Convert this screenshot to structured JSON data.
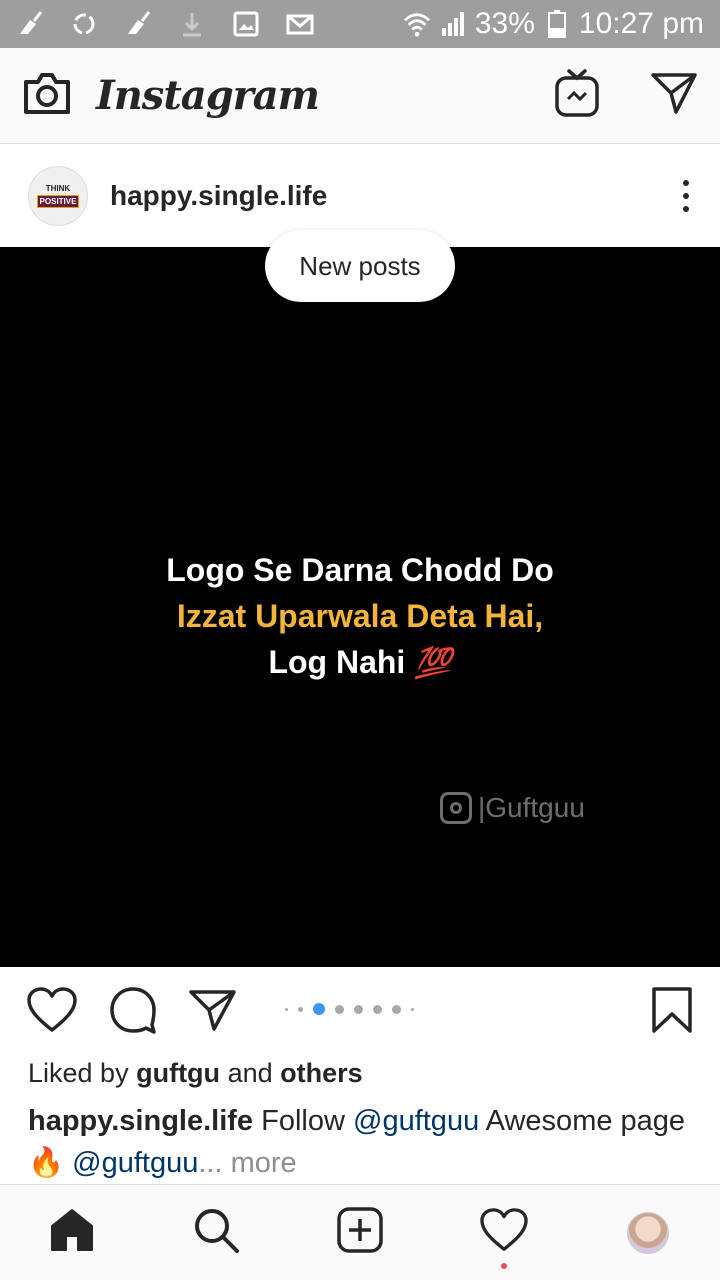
{
  "status_bar": {
    "battery": "33%",
    "time": "10:27 pm",
    "icons": [
      "broom-icon",
      "sync-icon",
      "broom-icon",
      "download-icon",
      "image-icon",
      "mail-icon",
      "wifi-icon",
      "signal-icon",
      "battery-icon"
    ]
  },
  "app_bar": {
    "title": "Instagram",
    "left_icon": "camera-icon",
    "right_icons": [
      "igtv-icon",
      "direct-message-icon"
    ]
  },
  "post": {
    "username": "happy.single.life",
    "avatar_text_top": "THINK",
    "avatar_text_bottom": "POSITIVE",
    "new_posts_label": "New posts",
    "media": {
      "line1": "Logo Se Darna Chodd Do",
      "line2": "Izzat Uparwala Deta Hai,",
      "line3": "Log Nahi",
      "emoji": "💯",
      "watermark": "|Guftguu"
    },
    "carousel": {
      "count": 8,
      "active_index": 2
    },
    "likes": {
      "prefix": "Liked by",
      "user": "guftgu",
      "and": "and",
      "others": "others"
    },
    "caption": {
      "user": "happy.single.life",
      "text1": "Follow",
      "mention1": "@guftguu",
      "text2": "Awesome page",
      "emoji": "🔥",
      "mention2": "@guftguu",
      "ellipsis": "...",
      "more": "more"
    }
  },
  "bottom_nav": {
    "items": [
      "home-icon",
      "search-icon",
      "new-post-icon",
      "activity-icon",
      "profile-icon"
    ]
  },
  "colors": {
    "status_bar_bg": "#9e9e9e",
    "quote_accent": "#f4b43a",
    "carousel_active": "#3897f0",
    "mention": "#003569",
    "notification": "#ed4956"
  }
}
